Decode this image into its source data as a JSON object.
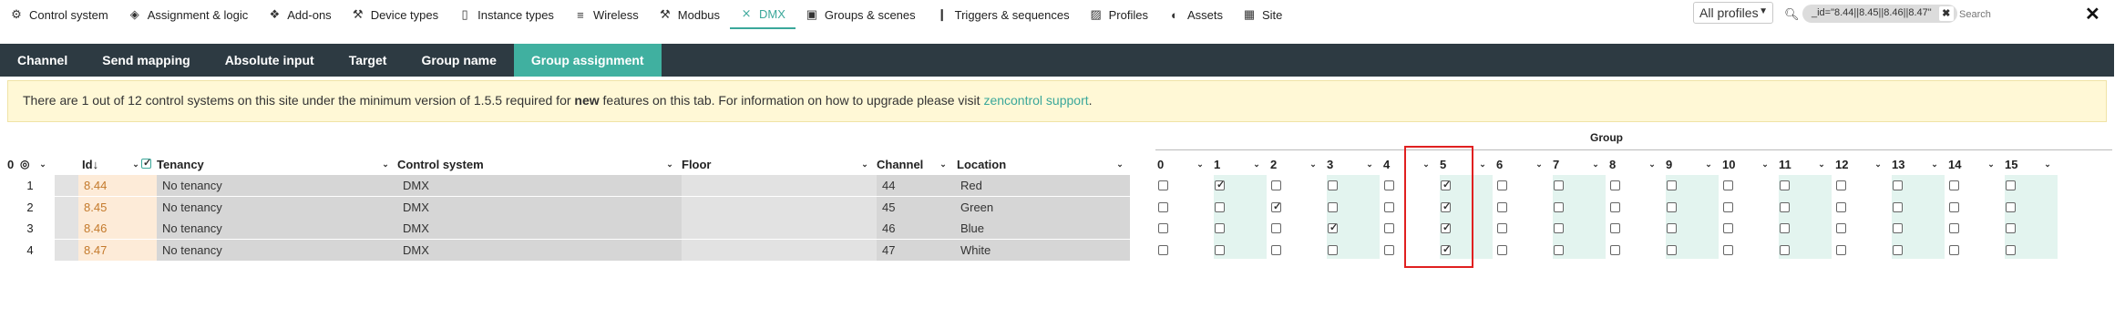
{
  "nav": {
    "items": [
      {
        "label": "Control system",
        "icon": "gear-icon"
      },
      {
        "label": "Assignment & logic",
        "icon": "tag-icon"
      },
      {
        "label": "Add-ons",
        "icon": "puzzle-icon"
      },
      {
        "label": "Device types",
        "icon": "wrench-icon"
      },
      {
        "label": "Instance types",
        "icon": "document-icon"
      },
      {
        "label": "Wireless",
        "icon": "wifi-icon"
      },
      {
        "label": "Modbus",
        "icon": "tool-icon"
      },
      {
        "label": "DMX",
        "icon": "dmx-icon"
      },
      {
        "label": "Groups & scenes",
        "icon": "groups-icon"
      },
      {
        "label": "Triggers & sequences",
        "icon": "bars-icon"
      },
      {
        "label": "Profiles",
        "icon": "profile-icon"
      },
      {
        "label": "Assets",
        "icon": "palette-icon"
      },
      {
        "label": "Site",
        "icon": "building-icon"
      }
    ],
    "active": "DMX",
    "profiles_select": "All profiles",
    "filter_chip": "_id=\"8.44||8.45||8.46||8.47\"",
    "search_placeholder": "Search",
    "accent": "#3aa79a"
  },
  "tabs": [
    {
      "label": "Channel"
    },
    {
      "label": "Send mapping"
    },
    {
      "label": "Absolute input"
    },
    {
      "label": "Target"
    },
    {
      "label": "Group name"
    },
    {
      "label": "Group assignment"
    }
  ],
  "active_tab": "Group assignment",
  "banner": {
    "text_before": "There are 1 out of 12 control systems on this site under the minimum version of 1.5.5 required for ",
    "bold": "new",
    "text_after": " features on this tab. For information on how to upgrade please visit ",
    "link": "zencontrol support",
    "end": "."
  },
  "table": {
    "group_header": "Group",
    "row_count_header": "0",
    "columns": {
      "id": "Id",
      "tenancy": "Tenancy",
      "control_system": "Control system",
      "floor": "Floor",
      "channel": "Channel",
      "location": "Location"
    },
    "groups": [
      "0",
      "1",
      "2",
      "3",
      "4",
      "5",
      "6",
      "7",
      "8",
      "9",
      "10",
      "11",
      "12",
      "13",
      "14",
      "15"
    ],
    "rows": [
      {
        "n": "1",
        "id": "8.44",
        "tenancy": "No tenancy",
        "control_system": "DMX",
        "floor": "",
        "channel": "44",
        "location": "Red",
        "checked": [
          1,
          5
        ]
      },
      {
        "n": "2",
        "id": "8.45",
        "tenancy": "No tenancy",
        "control_system": "DMX",
        "floor": "",
        "channel": "45",
        "location": "Green",
        "checked": [
          2,
          5
        ]
      },
      {
        "n": "3",
        "id": "8.46",
        "tenancy": "No tenancy",
        "control_system": "DMX",
        "floor": "",
        "channel": "46",
        "location": "Blue",
        "checked": [
          3,
          5
        ]
      },
      {
        "n": "4",
        "id": "8.47",
        "tenancy": "No tenancy",
        "control_system": "DMX",
        "floor": "",
        "channel": "47",
        "location": "White",
        "checked": [
          5
        ]
      }
    ]
  }
}
